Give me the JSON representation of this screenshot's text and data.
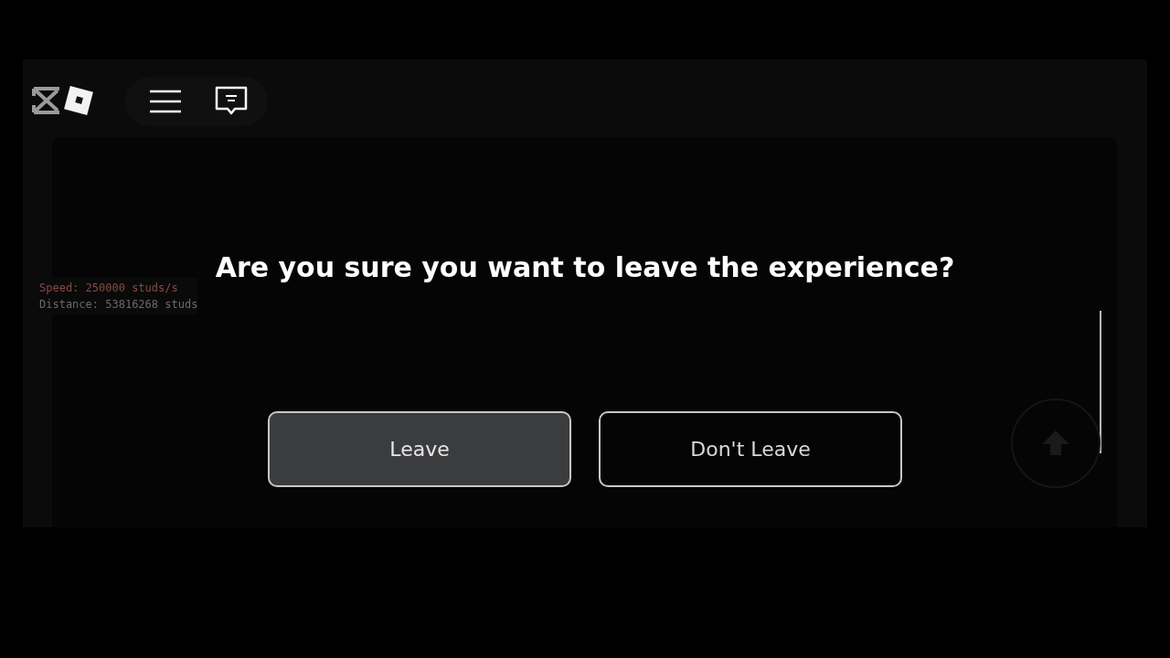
{
  "hud": {
    "speed": "Speed: 250000 studs/s",
    "distance": "Distance: 53816268 studs"
  },
  "dialog": {
    "title": "Are you sure you want to leave the experience?",
    "buttons": [
      {
        "label": "Leave",
        "selected": true
      },
      {
        "label": "Don't Leave",
        "selected": false
      }
    ]
  }
}
